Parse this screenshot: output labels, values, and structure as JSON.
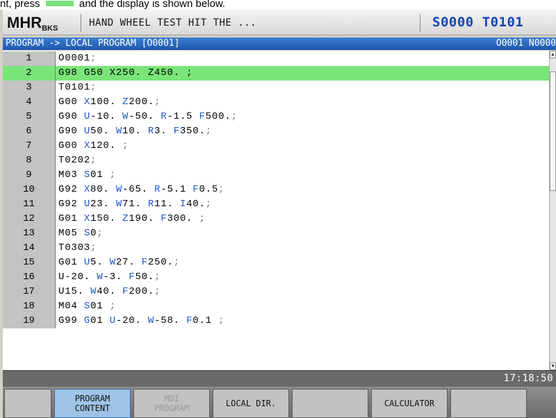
{
  "document": {
    "text_before": "nt, press",
    "text_after": "and the display is shown below."
  },
  "titlebar": {
    "mode": "MHR",
    "mode_sub": "BKS",
    "message": "HAND WHEEL TEST HIT THE ...",
    "spindle_tool": "S0000 T0101"
  },
  "pathbar": {
    "path": "PROGRAM -> LOCAL PROGRAM [O0001]",
    "prog_info": "O0001 N0000"
  },
  "editor": {
    "active_line": 2,
    "lines": [
      {
        "no": "1",
        "tokens": [
          {
            "t": "O0001",
            "c": ""
          },
          {
            "t": ";",
            "c": "sem"
          }
        ]
      },
      {
        "no": "2",
        "tokens": [
          {
            "t": "G98 G50 X250. Z450. ;",
            "c": ""
          }
        ]
      },
      {
        "no": "3",
        "tokens": [
          {
            "t": "T0101",
            "c": ""
          },
          {
            "t": ";",
            "c": "sem"
          }
        ]
      },
      {
        "no": "4",
        "tokens": [
          {
            "t": "G00 X100. Z200.",
            "c": ""
          },
          {
            "t": ";",
            "c": "sem"
          }
        ]
      },
      {
        "no": "5",
        "tokens": [
          {
            "t": "G90 U-10. W-50. R-1.5 F500.",
            "c": ""
          },
          {
            "t": ";",
            "c": "sem"
          }
        ]
      },
      {
        "no": "6",
        "tokens": [
          {
            "t": "G90 U50. W10. R3. F350.",
            "c": ""
          },
          {
            "t": ";",
            "c": "sem"
          }
        ]
      },
      {
        "no": "7",
        "tokens": [
          {
            "t": "G00 X120. ",
            "c": ""
          },
          {
            "t": ";",
            "c": "sem"
          }
        ]
      },
      {
        "no": "8",
        "tokens": [
          {
            "t": "T0202",
            "c": ""
          },
          {
            "t": ";",
            "c": "sem"
          }
        ]
      },
      {
        "no": "9",
        "tokens": [
          {
            "t": "M03 S01 ",
            "c": ""
          },
          {
            "t": ";",
            "c": "sem"
          }
        ]
      },
      {
        "no": "10",
        "tokens": [
          {
            "t": "G92 X80. W-65. R-5.1 F0.5",
            "c": ""
          },
          {
            "t": ";",
            "c": "sem"
          }
        ]
      },
      {
        "no": "11",
        "tokens": [
          {
            "t": "G92 U23. W71. R11. I40.",
            "c": ""
          },
          {
            "t": ";",
            "c": "sem"
          }
        ]
      },
      {
        "no": "12",
        "tokens": [
          {
            "t": "G01 X150. Z190. F300. ",
            "c": ""
          },
          {
            "t": ";",
            "c": "sem"
          }
        ]
      },
      {
        "no": "13",
        "tokens": [
          {
            "t": "M05 S0",
            "c": ""
          },
          {
            "t": ";",
            "c": "sem"
          }
        ]
      },
      {
        "no": "14",
        "tokens": [
          {
            "t": "T0303",
            "c": ""
          },
          {
            "t": ";",
            "c": "sem"
          }
        ]
      },
      {
        "no": "15",
        "tokens": [
          {
            "t": "G01 U5. W27. F250.",
            "c": ""
          },
          {
            "t": ";",
            "c": "sem"
          }
        ]
      },
      {
        "no": "16",
        "tokens": [
          {
            "t": "U-20. W-3. F50.",
            "c": ""
          },
          {
            "t": ";",
            "c": "sem"
          }
        ]
      },
      {
        "no": "17",
        "tokens": [
          {
            "t": "U15. W40. F200.",
            "c": ""
          },
          {
            "t": ";",
            "c": "sem"
          }
        ]
      },
      {
        "no": "18",
        "tokens": [
          {
            "t": "M04 S01 ",
            "c": ""
          },
          {
            "t": ";",
            "c": "sem"
          }
        ]
      },
      {
        "no": "19",
        "tokens": [
          {
            "t": "G99 G01 U-20. W-58. F0.1 ",
            "c": ""
          },
          {
            "t": ";",
            "c": "sem"
          }
        ]
      }
    ]
  },
  "scrollbar": {
    "up_icon": "triangle-up-icon",
    "down_icon": "triangle-down-icon"
  },
  "status": {
    "time": "17:18:50"
  },
  "softkeys": [
    {
      "label": "",
      "state": "normal"
    },
    {
      "label": "PROGRAM\nCONTENT",
      "state": "selected"
    },
    {
      "label": "MDI\nPROGRAM",
      "state": "disabled"
    },
    {
      "label": "LOCAL DIR.",
      "state": "normal"
    },
    {
      "label": "",
      "state": "normal"
    },
    {
      "label": "CALCULATOR",
      "state": "normal"
    },
    {
      "label": "",
      "state": "normal"
    }
  ],
  "colors": {
    "active_line": "#79e579",
    "address_letter": "#1d57c9",
    "pathbar": "#2a68bd",
    "spindle_text": "#1246b8",
    "selected_softkey": "#9ec3e6"
  }
}
